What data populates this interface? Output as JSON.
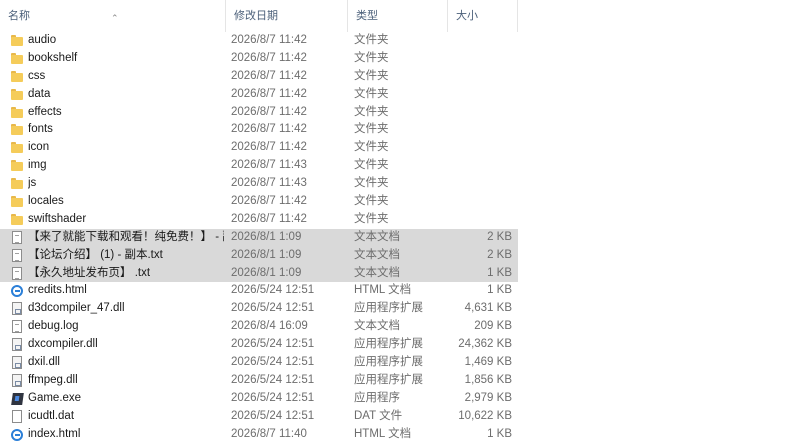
{
  "columns": {
    "name": "名称",
    "date": "修改日期",
    "type": "类型",
    "size": "大小"
  },
  "files": [
    {
      "name": "audio",
      "date": "2026/8/7 11:42",
      "type": "文件夹",
      "size": "",
      "icon": "folder-icon",
      "selected": false
    },
    {
      "name": "bookshelf",
      "date": "2026/8/7 11:42",
      "type": "文件夹",
      "size": "",
      "icon": "folder-icon",
      "selected": false
    },
    {
      "name": "css",
      "date": "2026/8/7 11:42",
      "type": "文件夹",
      "size": "",
      "icon": "folder-icon",
      "selected": false
    },
    {
      "name": "data",
      "date": "2026/8/7 11:42",
      "type": "文件夹",
      "size": "",
      "icon": "folder-icon",
      "selected": false
    },
    {
      "name": "effects",
      "date": "2026/8/7 11:42",
      "type": "文件夹",
      "size": "",
      "icon": "folder-icon",
      "selected": false
    },
    {
      "name": "fonts",
      "date": "2026/8/7 11:42",
      "type": "文件夹",
      "size": "",
      "icon": "folder-icon",
      "selected": false
    },
    {
      "name": "icon",
      "date": "2026/8/7 11:42",
      "type": "文件夹",
      "size": "",
      "icon": "folder-icon",
      "selected": false
    },
    {
      "name": "img",
      "date": "2026/8/7 11:43",
      "type": "文件夹",
      "size": "",
      "icon": "folder-icon",
      "selected": false
    },
    {
      "name": "js",
      "date": "2026/8/7 11:43",
      "type": "文件夹",
      "size": "",
      "icon": "folder-icon",
      "selected": false
    },
    {
      "name": "locales",
      "date": "2026/8/7 11:42",
      "type": "文件夹",
      "size": "",
      "icon": "folder-icon",
      "selected": false
    },
    {
      "name": "swiftshader",
      "date": "2026/8/7 11:42",
      "type": "文件夹",
      "size": "",
      "icon": "folder-icon",
      "selected": false
    },
    {
      "name": "【来了就能下载和观看！纯免费！】 - 副...",
      "date": "2026/8/1 1:09",
      "type": "文本文档",
      "size": "2 KB",
      "icon": "text-document-icon",
      "selected": true
    },
    {
      "name": "【论坛介绍】 (1) - 副本.txt",
      "date": "2026/8/1 1:09",
      "type": "文本文档",
      "size": "2 KB",
      "icon": "text-document-icon",
      "selected": true
    },
    {
      "name": "【永久地址发布页】 .txt",
      "date": "2026/8/1 1:09",
      "type": "文本文档",
      "size": "1 KB",
      "icon": "text-document-icon",
      "selected": true
    },
    {
      "name": "credits.html",
      "date": "2026/5/24 12:51",
      "type": "HTML 文档",
      "size": "1 KB",
      "icon": "html-document-icon",
      "selected": false
    },
    {
      "name": "d3dcompiler_47.dll",
      "date": "2026/5/24 12:51",
      "type": "应用程序扩展",
      "size": "4,631 KB",
      "icon": "dll-icon",
      "selected": false
    },
    {
      "name": "debug.log",
      "date": "2026/8/4 16:09",
      "type": "文本文档",
      "size": "209 KB",
      "icon": "text-document-icon",
      "selected": false
    },
    {
      "name": "dxcompiler.dll",
      "date": "2026/5/24 12:51",
      "type": "应用程序扩展",
      "size": "24,362 KB",
      "icon": "dll-icon",
      "selected": false
    },
    {
      "name": "dxil.dll",
      "date": "2026/5/24 12:51",
      "type": "应用程序扩展",
      "size": "1,469 KB",
      "icon": "dll-icon",
      "selected": false
    },
    {
      "name": "ffmpeg.dll",
      "date": "2026/5/24 12:51",
      "type": "应用程序扩展",
      "size": "1,856 KB",
      "icon": "dll-icon",
      "selected": false
    },
    {
      "name": "Game.exe",
      "date": "2026/5/24 12:51",
      "type": "应用程序",
      "size": "2,979 KB",
      "icon": "game-exe-icon",
      "selected": false
    },
    {
      "name": "icudtl.dat",
      "date": "2026/5/24 12:51",
      "type": "DAT 文件",
      "size": "10,622 KB",
      "icon": "file-icon",
      "selected": false
    },
    {
      "name": "index.html",
      "date": "2026/8/7 11:40",
      "type": "HTML 文档",
      "size": "1 KB",
      "icon": "html-document-icon",
      "selected": false
    }
  ]
}
